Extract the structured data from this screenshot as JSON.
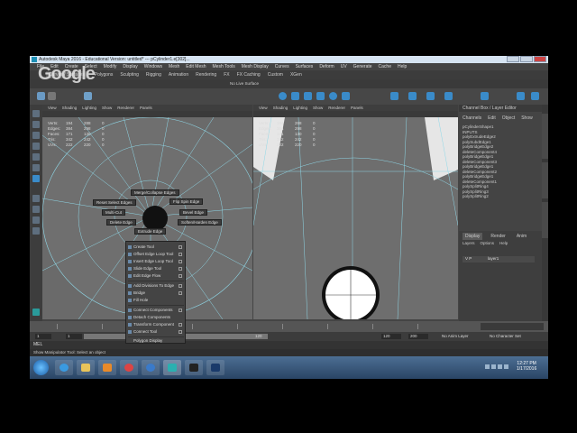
{
  "window": {
    "title": "Autodesk Maya 2016 - Educational Version: untitled*  ---  pCylinder1.e[302]..."
  },
  "overlay": {
    "logo_text": "Google"
  },
  "menubar": [
    "File",
    "Edit",
    "Create",
    "Select",
    "Modify",
    "Display",
    "Windows",
    "Mesh",
    "Edit Mesh",
    "Mesh Tools",
    "Mesh Display",
    "Curves",
    "Surfaces",
    "Deform",
    "UV",
    "Generate",
    "Cache",
    "Help"
  ],
  "shelf_tabs": [
    "Curves / Surfaces",
    "Polygons",
    "Sculpting",
    "Rigging",
    "Animation",
    "Rendering",
    "FX",
    "FX Caching",
    "Custom",
    "XGen"
  ],
  "status_label": "No Live Surface",
  "viewport_menu": [
    "View",
    "Shading",
    "Lighting",
    "Show",
    "Renderer",
    "Panels"
  ],
  "hud": {
    "rows": [
      {
        "label": "Verts:",
        "a": "194",
        "b": "288",
        "c": "0"
      },
      {
        "label": "Edges:",
        "a": "384",
        "b": "298",
        "c": "0"
      },
      {
        "label": "Faces:",
        "a": "171",
        "b": "130",
        "c": "0"
      },
      {
        "label": "Tris:",
        "a": "342",
        "b": "242",
        "c": "0"
      },
      {
        "label": "UVs:",
        "a": "222",
        "b": "220",
        "c": "0"
      }
    ]
  },
  "channel_box": {
    "tab": "Channel Box / Layer Editor",
    "menu": [
      "Channels",
      "Edit",
      "Object",
      "Show"
    ],
    "items": [
      "pCylinderShape1",
      "INPUTS",
      "polyExtrudeEdge2",
      "polySubdEdge1",
      "polyBridgeEdge2",
      "deleteComponent4",
      "polyBridgeEdge1",
      "deleteComponent3",
      "polyBridgeEdge1",
      "deleteComponent2",
      "polyBridgeEdge1",
      "deleteComponent1",
      "polySplitRing4",
      "polySplitRing3",
      "polySplitRing2"
    ]
  },
  "layers": {
    "tabs": [
      "Display",
      "Render",
      "Anim"
    ],
    "menu": [
      "Layers",
      "Options",
      "Help"
    ],
    "row_label": "layer1",
    "row_flags": "V P"
  },
  "marking_menu": {
    "north": "Merge/Collapse Edges",
    "nw": "Reset Select Edges",
    "ne": "Flip Spin Edge",
    "west": "Multi-Cut",
    "east": "Bevel Edge",
    "sw": "Delete Edge",
    "se": "Soften/Harden Edge",
    "south": "Extrude Edge"
  },
  "context_menu": [
    "Create Tool",
    "Offset Edge Loop Tool",
    "Insert Edge Loop Tool",
    "Slide Edge Tool",
    "Edit Edge Flow",
    "Add Divisions To Edge",
    "Bridge",
    "Fill Hole",
    "Connect Components",
    "Detach Components",
    "Transform Component",
    "Connect Tool",
    "Polygon Display"
  ],
  "range": {
    "start": "1",
    "start2": "1",
    "frame": "120",
    "end": "120",
    "end2": "200",
    "anim_layer": "No Anim Layer",
    "char_set": "No Character Set"
  },
  "mel": {
    "label": "MEL"
  },
  "help": {
    "text": "Show Manipulator Tool: Select an object"
  },
  "clock": {
    "time": "12:27 PM",
    "date": "1/17/2016"
  }
}
